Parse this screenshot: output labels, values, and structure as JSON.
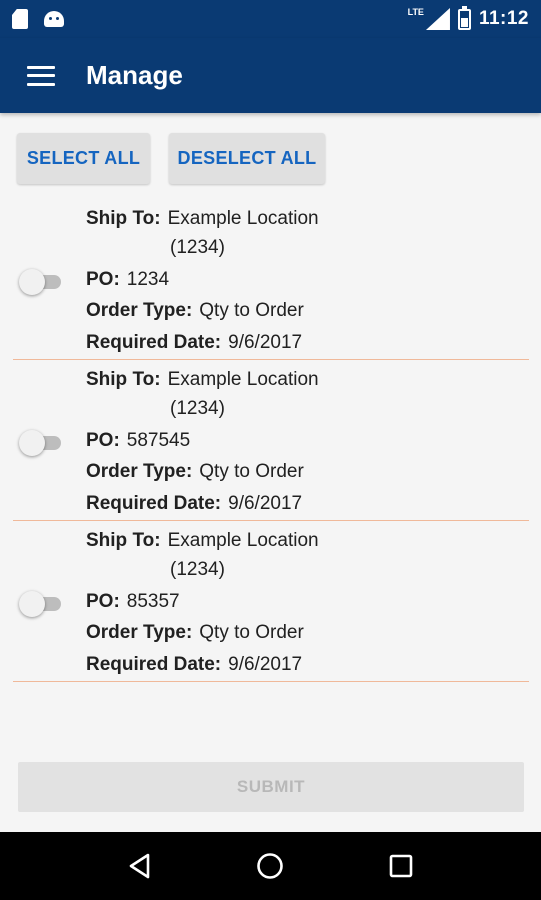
{
  "status_bar": {
    "network_label": "LTE",
    "time": "11:12",
    "icons": [
      "sd-card-icon",
      "android-icon",
      "signal-icon",
      "battery-icon"
    ]
  },
  "app_bar": {
    "title": "Manage",
    "menu_icon": "hamburger-menu-icon"
  },
  "actions": {
    "select_all": "SELECT ALL",
    "deselect_all": "DESELECT ALL"
  },
  "labels": {
    "ship_to": "Ship To:",
    "po": "PO:",
    "order_type": "Order Type:",
    "required_date": "Required Date:"
  },
  "orders": [
    {
      "selected": false,
      "ship_to_line1": "Example Location",
      "ship_to_line2": "(1234)",
      "po": "1234",
      "order_type": "Qty to Order",
      "required_date": "9/6/2017"
    },
    {
      "selected": false,
      "ship_to_line1": "Example Location",
      "ship_to_line2": "(1234)",
      "po": "587545",
      "order_type": "Qty to Order",
      "required_date": "9/6/2017"
    },
    {
      "selected": false,
      "ship_to_line1": "Example Location",
      "ship_to_line2": "(1234)",
      "po": "85357",
      "order_type": "Qty to Order",
      "required_date": "9/6/2017"
    }
  ],
  "submit": {
    "label": "SUBMIT",
    "enabled": false
  },
  "nav_bar": {
    "icons": [
      "back-icon",
      "home-icon",
      "recents-icon"
    ]
  },
  "colors": {
    "primary": "#0a3a73",
    "accent_text": "#1565c0",
    "divider": "#f0b99a",
    "background": "#f5f5f5"
  }
}
